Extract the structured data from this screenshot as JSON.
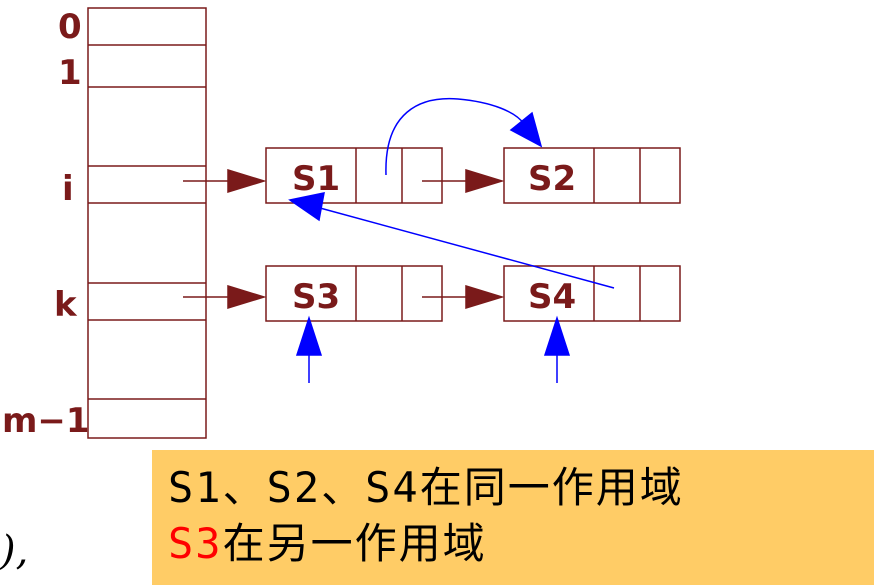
{
  "table": {
    "row_labels": [
      "0",
      "1",
      "i",
      "k",
      "m−1"
    ]
  },
  "nodes": {
    "s1": "S1",
    "s2": "S2",
    "s3": "S3",
    "s4": "S4"
  },
  "note": {
    "line1": "S1、S2、S4在同一作用域",
    "line2_red": "S3",
    "line2_rest": "在另一作用域"
  },
  "stray_text": "),",
  "colors": {
    "structure": "#7a1a1a",
    "pointer": "#0000ff",
    "note_bg": "#ffcc66",
    "highlight": "#ff0000"
  }
}
